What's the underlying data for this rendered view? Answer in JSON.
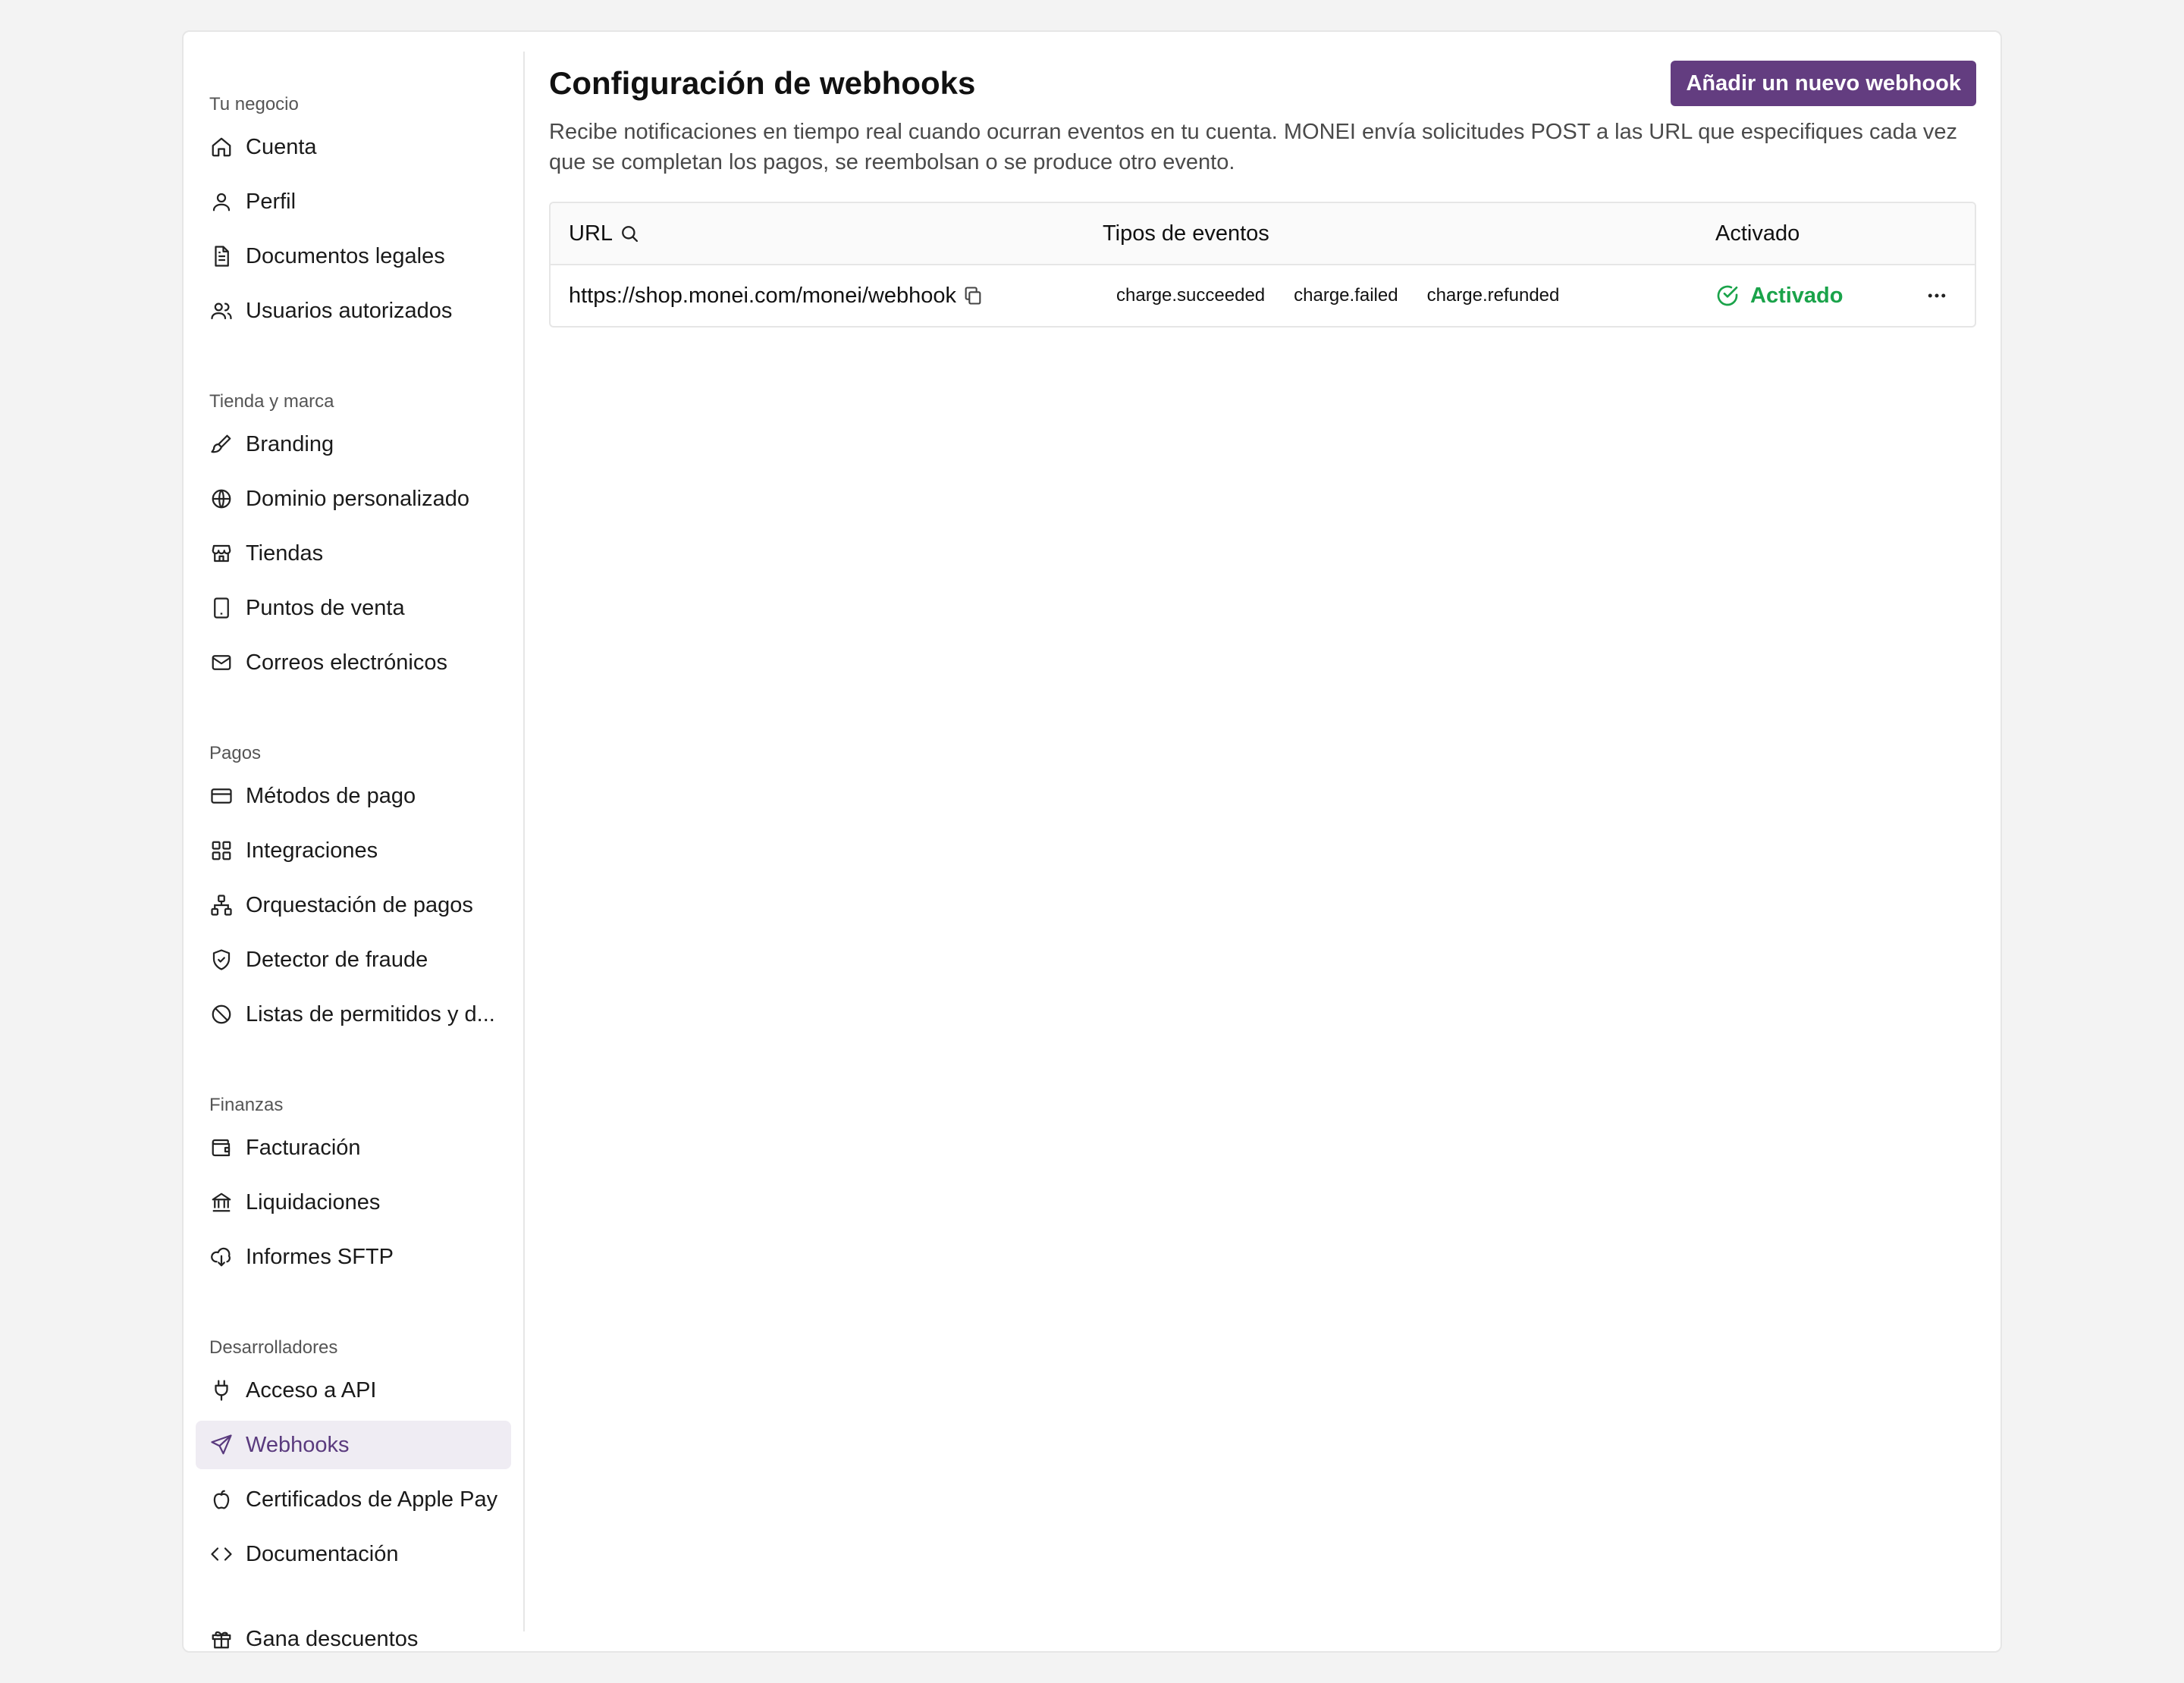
{
  "sidebar": {
    "groups": [
      {
        "label": "Tu negocio",
        "items": [
          {
            "label": "Cuenta",
            "icon": "home-icon"
          },
          {
            "label": "Perfil",
            "icon": "user-icon"
          },
          {
            "label": "Documentos legales",
            "icon": "document-icon"
          },
          {
            "label": "Usuarios autorizados",
            "icon": "users-icon"
          }
        ]
      },
      {
        "label": "Tienda y marca",
        "items": [
          {
            "label": "Branding",
            "icon": "paintbrush-icon"
          },
          {
            "label": "Dominio personalizado",
            "icon": "globe-icon"
          },
          {
            "label": "Tiendas",
            "icon": "store-icon"
          },
          {
            "label": "Puntos de venta",
            "icon": "tablet-icon"
          },
          {
            "label": "Correos electrónicos",
            "icon": "mail-icon"
          }
        ]
      },
      {
        "label": "Pagos",
        "items": [
          {
            "label": "Métodos de pago",
            "icon": "credit-card-icon"
          },
          {
            "label": "Integraciones",
            "icon": "grid-icon"
          },
          {
            "label": "Orquestación de pagos",
            "icon": "network-icon"
          },
          {
            "label": "Detector de fraude",
            "icon": "shield-check-icon"
          },
          {
            "label": "Listas de permitidos y d...",
            "icon": "ban-icon"
          }
        ]
      },
      {
        "label": "Finanzas",
        "items": [
          {
            "label": "Facturación",
            "icon": "wallet-icon"
          },
          {
            "label": "Liquidaciones",
            "icon": "bank-icon"
          },
          {
            "label": "Informes SFTP",
            "icon": "cloud-download-icon"
          }
        ]
      },
      {
        "label": "Desarrolladores",
        "items": [
          {
            "label": "Acceso a API",
            "icon": "plug-icon"
          },
          {
            "label": "Webhooks",
            "icon": "send-icon",
            "active": true
          },
          {
            "label": "Certificados de Apple Pay",
            "icon": "apple-icon"
          },
          {
            "label": "Documentación",
            "icon": "code-icon"
          }
        ]
      }
    ],
    "footer_item": {
      "label": "Gana descuentos",
      "icon": "gift-icon"
    }
  },
  "main": {
    "title": "Configuración de webhooks",
    "add_button": "Añadir un nuevo webhook",
    "description": "Recibe notificaciones en tiempo real cuando ocurran eventos en tu cuenta. MONEI envía solicitudes POST a las URL que especifiques cada vez que se completan los pagos, se reembolsan o se produce otro evento.",
    "table": {
      "columns": {
        "url": "URL",
        "events": "Tipos de eventos",
        "enabled": "Activado"
      },
      "rows": [
        {
          "url": "https://shop.monei.com/monei/webhook",
          "events": [
            "charge.succeeded",
            "charge.failed",
            "charge.refunded"
          ],
          "status": "Activado"
        }
      ]
    }
  },
  "colors": {
    "accent": "#633d80",
    "active_bg": "#efecf3",
    "status_green": "#1aa34a"
  }
}
